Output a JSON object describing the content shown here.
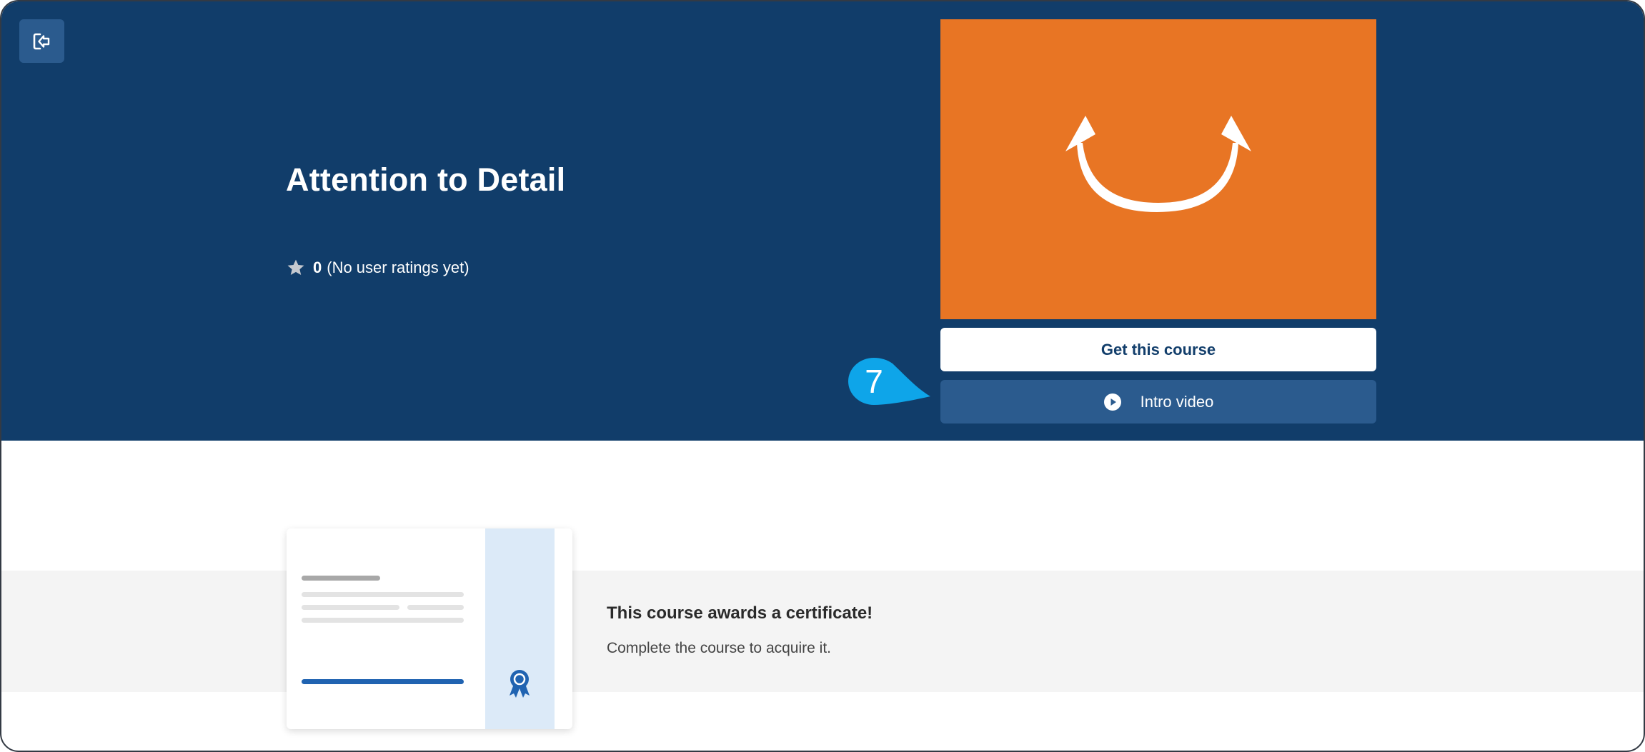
{
  "hero": {
    "title": "Attention to Detail",
    "rating": {
      "value": "0",
      "text": "(No user ratings yet)"
    },
    "exit_icon": "exit-icon",
    "thumbnail_icon": "smile-arrows-icon",
    "buttons": {
      "get_course_label": "Get this course",
      "intro_video_label": "Intro video"
    }
  },
  "step_marker": {
    "number": "7"
  },
  "certificate": {
    "title": "This course awards a certificate!",
    "description": "Complete the course to acquire it."
  },
  "colors": {
    "hero_bg": "#113d6a",
    "button_secondary": "#2b5b8e",
    "thumbnail_orange": "#e87524",
    "marker_blue": "#0ea5e9",
    "cert_accent": "#2063b1"
  }
}
